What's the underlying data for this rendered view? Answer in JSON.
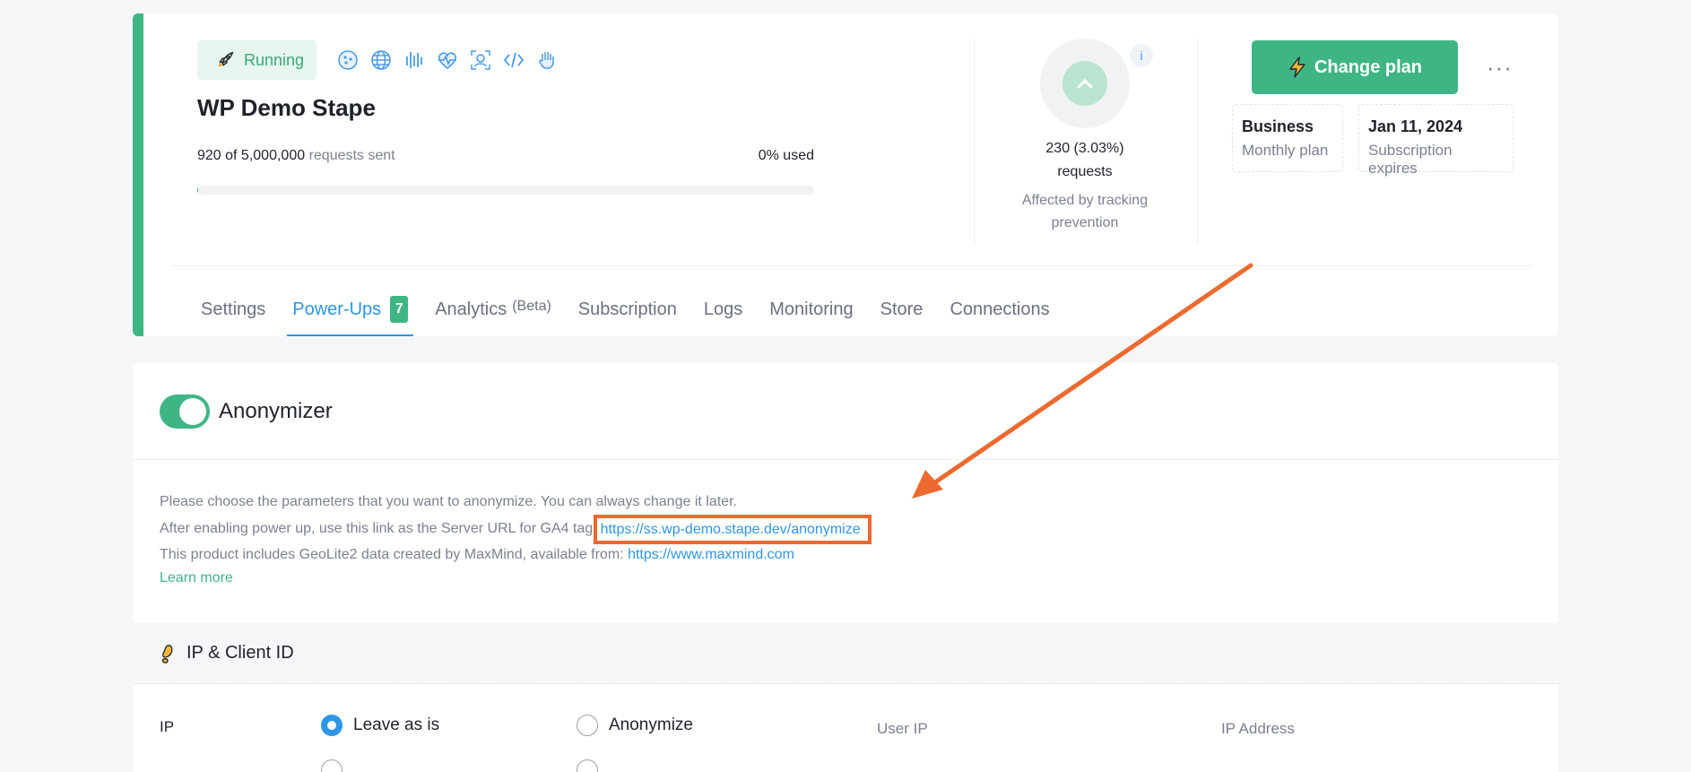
{
  "container": {
    "status": "Running",
    "name": "WP Demo Stape",
    "requests_used": "920 of 5,000,000",
    "requests_label": "requests sent",
    "used_percent": "0% used",
    "usage_fraction": 0.0002
  },
  "powerup_icons": [
    "cookie-icon",
    "globe-icon",
    "audio-bars-icon",
    "heartbeat-icon",
    "face-scan-icon",
    "code-icon",
    "hand-icon"
  ],
  "tracking": {
    "value": "230 (3.03%)",
    "unit": "requests",
    "note": "Affected by tracking prevention",
    "info": "i"
  },
  "plan": {
    "change_label": "Change plan",
    "more": "···",
    "name": "Business",
    "type": "Monthly plan",
    "expires_date": "Jan 11, 2024",
    "expires_label": "Subscription expires"
  },
  "tabs": [
    {
      "label": "Settings"
    },
    {
      "label": "Power-Ups",
      "count": "7",
      "active": true
    },
    {
      "label": "Analytics",
      "beta": "(Beta)"
    },
    {
      "label": "Subscription"
    },
    {
      "label": "Logs"
    },
    {
      "label": "Monitoring"
    },
    {
      "label": "Store"
    },
    {
      "label": "Connections"
    }
  ],
  "anonymizer": {
    "title": "Anonymizer",
    "enabled": true,
    "line1": "Please choose the parameters that you want to anonymize. You can always change it later.",
    "line2_prefix": "After enabling power up, use this link as the Server URL for GA4 tag",
    "line2_link": "https://ss.wp-demo.stape.dev/anonymize",
    "line3_prefix": "This product includes GeoLite2 data created by MaxMind, available from:",
    "line3_link": "https://www.maxmind.com",
    "learn_more": "Learn more"
  },
  "ip_section": {
    "title": "IP & Client ID",
    "row_label": "IP",
    "options": [
      "Leave as is",
      "Anonymize"
    ],
    "selected": "Leave as is",
    "col_user_ip": "User IP",
    "col_ip_address": "IP Address"
  },
  "colors": {
    "accent_green": "#3fb585",
    "link_blue": "#2f95e6",
    "annotation_orange": "#ec6a2f"
  }
}
